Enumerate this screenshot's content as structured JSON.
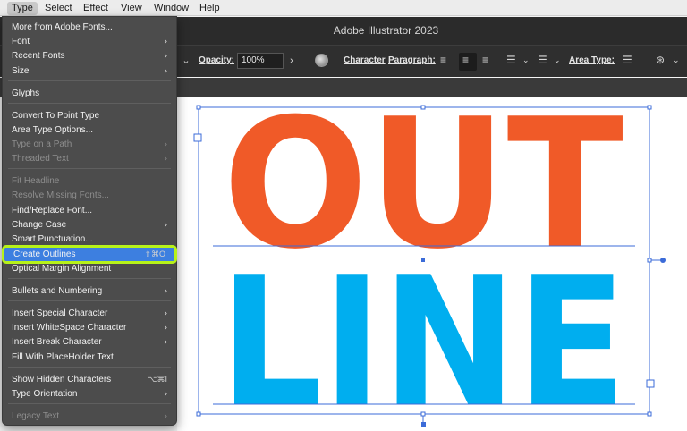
{
  "menubar": {
    "items": [
      "Type",
      "Select",
      "Effect",
      "View",
      "Window",
      "Help"
    ],
    "active": "Type"
  },
  "app": {
    "title": "Adobe Illustrator 2023"
  },
  "controlbar": {
    "opacity_label": "Opacity:",
    "opacity_value": "100%",
    "character": "Character",
    "paragraph": "Paragraph:",
    "area_type": "Area Type:"
  },
  "type_menu": {
    "items": [
      {
        "label": "More from Adobe Fonts...",
        "submenu": false,
        "disabled": false
      },
      {
        "label": "Font",
        "submenu": true,
        "disabled": false
      },
      {
        "label": "Recent Fonts",
        "submenu": true,
        "disabled": false
      },
      {
        "label": "Size",
        "submenu": true,
        "disabled": false
      },
      {
        "label": "Glyphs",
        "submenu": false,
        "disabled": false
      },
      {
        "label": "Convert To Point Type",
        "submenu": false,
        "disabled": false
      },
      {
        "label": "Area Type Options...",
        "submenu": false,
        "disabled": false
      },
      {
        "label": "Type on a Path",
        "submenu": true,
        "disabled": true
      },
      {
        "label": "Threaded Text",
        "submenu": true,
        "disabled": true
      },
      {
        "label": "Fit Headline",
        "submenu": false,
        "disabled": true
      },
      {
        "label": "Resolve Missing Fonts...",
        "submenu": false,
        "disabled": true
      },
      {
        "label": "Find/Replace Font...",
        "submenu": false,
        "disabled": false
      },
      {
        "label": "Change Case",
        "submenu": true,
        "disabled": false
      },
      {
        "label": "Smart Punctuation...",
        "submenu": false,
        "disabled": false
      },
      {
        "label": "Create Outlines",
        "submenu": false,
        "disabled": false,
        "highlight": true,
        "shortcut": "⇧⌘O"
      },
      {
        "label": "Optical Margin Alignment",
        "submenu": false,
        "disabled": false
      },
      {
        "label": "Bullets and Numbering",
        "submenu": true,
        "disabled": false
      },
      {
        "label": "Insert Special Character",
        "submenu": true,
        "disabled": false
      },
      {
        "label": "Insert WhiteSpace Character",
        "submenu": true,
        "disabled": false
      },
      {
        "label": "Insert Break Character",
        "submenu": true,
        "disabled": false
      },
      {
        "label": "Fill With PlaceHolder Text",
        "submenu": false,
        "disabled": false
      },
      {
        "label": "Show Hidden Characters",
        "submenu": false,
        "disabled": false,
        "shortcut": "⌥⌘I"
      },
      {
        "label": "Type Orientation",
        "submenu": true,
        "disabled": false
      },
      {
        "label": "Legacy Text",
        "submenu": true,
        "disabled": true
      }
    ]
  },
  "artwork": {
    "line1": "OUT",
    "line2": "LINE",
    "line1_color": "#f05a28",
    "line2_color": "#00aeef",
    "selection_color": "#3b6bd8"
  },
  "colors": {
    "highlight_outline": "#b7f219",
    "menu_highlight": "#3d7fe0"
  }
}
